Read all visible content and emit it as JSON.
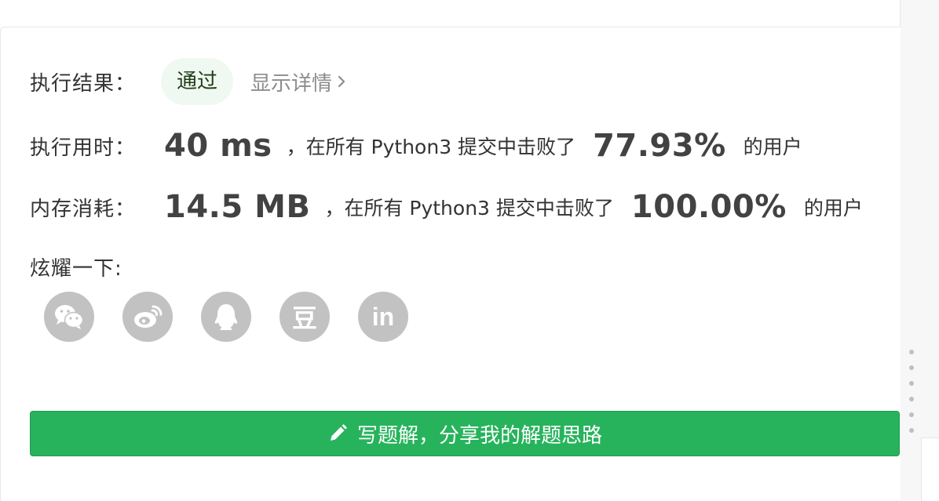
{
  "result": {
    "label": "执行结果：",
    "status": "通过",
    "details_link": "显示详情"
  },
  "runtime": {
    "label": "执行用时：",
    "value": "40 ms",
    "beat_text": "，在所有 Python3 提交中击败了",
    "percent": "77.93%",
    "users_text": "的用户"
  },
  "memory": {
    "label": "内存消耗：",
    "value": "14.5 MB",
    "beat_text": "，在所有 Python3 提交中击败了",
    "percent": "100.00%",
    "users_text": "的用户"
  },
  "share": {
    "label": "炫耀一下:",
    "buttons": [
      {
        "icon": "wechat-icon"
      },
      {
        "icon": "weibo-icon"
      },
      {
        "icon": "qq-icon"
      },
      {
        "icon": "douban-icon",
        "glyph": "豆"
      },
      {
        "icon": "linkedin-icon",
        "glyph": "in"
      }
    ]
  },
  "solution_button": {
    "label": "写题解，分享我的解题思路",
    "icon": "pencil-icon"
  },
  "colors": {
    "accent_green": "#27b35c",
    "badge_bg": "#f0f9f1",
    "icon_gray": "#c2c2c2"
  }
}
